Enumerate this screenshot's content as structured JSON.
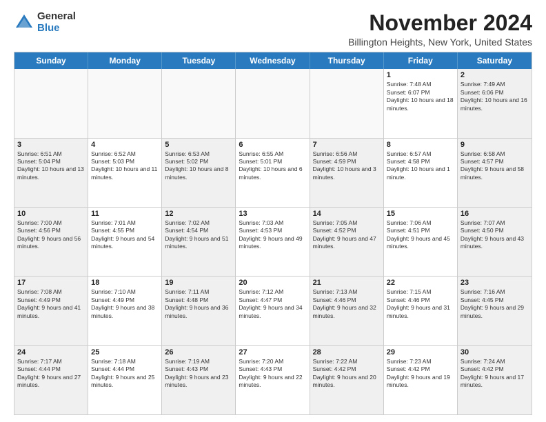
{
  "logo": {
    "general": "General",
    "blue": "Blue"
  },
  "title": "November 2024",
  "location": "Billington Heights, New York, United States",
  "days_of_week": [
    "Sunday",
    "Monday",
    "Tuesday",
    "Wednesday",
    "Thursday",
    "Friday",
    "Saturday"
  ],
  "weeks": [
    [
      {
        "day": "",
        "info": "",
        "empty": true
      },
      {
        "day": "",
        "info": "",
        "empty": true
      },
      {
        "day": "",
        "info": "",
        "empty": true
      },
      {
        "day": "",
        "info": "",
        "empty": true
      },
      {
        "day": "",
        "info": "",
        "empty": true
      },
      {
        "day": "1",
        "info": "Sunrise: 7:48 AM\nSunset: 6:07 PM\nDaylight: 10 hours and 18 minutes.",
        "empty": false
      },
      {
        "day": "2",
        "info": "Sunrise: 7:49 AM\nSunset: 6:06 PM\nDaylight: 10 hours and 16 minutes.",
        "empty": false
      }
    ],
    [
      {
        "day": "3",
        "info": "Sunrise: 6:51 AM\nSunset: 5:04 PM\nDaylight: 10 hours and 13 minutes.",
        "empty": false
      },
      {
        "day": "4",
        "info": "Sunrise: 6:52 AM\nSunset: 5:03 PM\nDaylight: 10 hours and 11 minutes.",
        "empty": false
      },
      {
        "day": "5",
        "info": "Sunrise: 6:53 AM\nSunset: 5:02 PM\nDaylight: 10 hours and 8 minutes.",
        "empty": false
      },
      {
        "day": "6",
        "info": "Sunrise: 6:55 AM\nSunset: 5:01 PM\nDaylight: 10 hours and 6 minutes.",
        "empty": false
      },
      {
        "day": "7",
        "info": "Sunrise: 6:56 AM\nSunset: 4:59 PM\nDaylight: 10 hours and 3 minutes.",
        "empty": false
      },
      {
        "day": "8",
        "info": "Sunrise: 6:57 AM\nSunset: 4:58 PM\nDaylight: 10 hours and 1 minute.",
        "empty": false
      },
      {
        "day": "9",
        "info": "Sunrise: 6:58 AM\nSunset: 4:57 PM\nDaylight: 9 hours and 58 minutes.",
        "empty": false
      }
    ],
    [
      {
        "day": "10",
        "info": "Sunrise: 7:00 AM\nSunset: 4:56 PM\nDaylight: 9 hours and 56 minutes.",
        "empty": false
      },
      {
        "day": "11",
        "info": "Sunrise: 7:01 AM\nSunset: 4:55 PM\nDaylight: 9 hours and 54 minutes.",
        "empty": false
      },
      {
        "day": "12",
        "info": "Sunrise: 7:02 AM\nSunset: 4:54 PM\nDaylight: 9 hours and 51 minutes.",
        "empty": false
      },
      {
        "day": "13",
        "info": "Sunrise: 7:03 AM\nSunset: 4:53 PM\nDaylight: 9 hours and 49 minutes.",
        "empty": false
      },
      {
        "day": "14",
        "info": "Sunrise: 7:05 AM\nSunset: 4:52 PM\nDaylight: 9 hours and 47 minutes.",
        "empty": false
      },
      {
        "day": "15",
        "info": "Sunrise: 7:06 AM\nSunset: 4:51 PM\nDaylight: 9 hours and 45 minutes.",
        "empty": false
      },
      {
        "day": "16",
        "info": "Sunrise: 7:07 AM\nSunset: 4:50 PM\nDaylight: 9 hours and 43 minutes.",
        "empty": false
      }
    ],
    [
      {
        "day": "17",
        "info": "Sunrise: 7:08 AM\nSunset: 4:49 PM\nDaylight: 9 hours and 41 minutes.",
        "empty": false
      },
      {
        "day": "18",
        "info": "Sunrise: 7:10 AM\nSunset: 4:49 PM\nDaylight: 9 hours and 38 minutes.",
        "empty": false
      },
      {
        "day": "19",
        "info": "Sunrise: 7:11 AM\nSunset: 4:48 PM\nDaylight: 9 hours and 36 minutes.",
        "empty": false
      },
      {
        "day": "20",
        "info": "Sunrise: 7:12 AM\nSunset: 4:47 PM\nDaylight: 9 hours and 34 minutes.",
        "empty": false
      },
      {
        "day": "21",
        "info": "Sunrise: 7:13 AM\nSunset: 4:46 PM\nDaylight: 9 hours and 32 minutes.",
        "empty": false
      },
      {
        "day": "22",
        "info": "Sunrise: 7:15 AM\nSunset: 4:46 PM\nDaylight: 9 hours and 31 minutes.",
        "empty": false
      },
      {
        "day": "23",
        "info": "Sunrise: 7:16 AM\nSunset: 4:45 PM\nDaylight: 9 hours and 29 minutes.",
        "empty": false
      }
    ],
    [
      {
        "day": "24",
        "info": "Sunrise: 7:17 AM\nSunset: 4:44 PM\nDaylight: 9 hours and 27 minutes.",
        "empty": false
      },
      {
        "day": "25",
        "info": "Sunrise: 7:18 AM\nSunset: 4:44 PM\nDaylight: 9 hours and 25 minutes.",
        "empty": false
      },
      {
        "day": "26",
        "info": "Sunrise: 7:19 AM\nSunset: 4:43 PM\nDaylight: 9 hours and 23 minutes.",
        "empty": false
      },
      {
        "day": "27",
        "info": "Sunrise: 7:20 AM\nSunset: 4:43 PM\nDaylight: 9 hours and 22 minutes.",
        "empty": false
      },
      {
        "day": "28",
        "info": "Sunrise: 7:22 AM\nSunset: 4:42 PM\nDaylight: 9 hours and 20 minutes.",
        "empty": false
      },
      {
        "day": "29",
        "info": "Sunrise: 7:23 AM\nSunset: 4:42 PM\nDaylight: 9 hours and 19 minutes.",
        "empty": false
      },
      {
        "day": "30",
        "info": "Sunrise: 7:24 AM\nSunset: 4:42 PM\nDaylight: 9 hours and 17 minutes.",
        "empty": false
      }
    ]
  ]
}
